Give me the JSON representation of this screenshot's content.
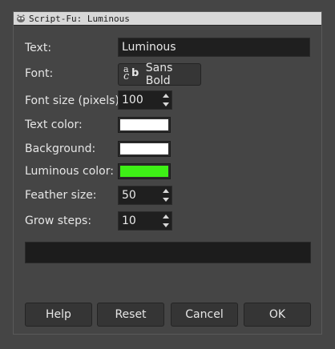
{
  "window": {
    "title": "Script-Fu: Luminous"
  },
  "fields": {
    "text": {
      "label": "Text:",
      "value": "Luminous"
    },
    "font": {
      "label": "Font:",
      "value": "Sans Bold",
      "glyph_top": "a",
      "glyph_bottom": "c",
      "glyph_bold": "b"
    },
    "font_size": {
      "label": "Font size (pixels):",
      "value": "100"
    },
    "text_color": {
      "label": "Text color:",
      "color": "#ffffff"
    },
    "background": {
      "label": "Background:",
      "color": "#ffffff"
    },
    "luminous_color": {
      "label": "Luminous color:",
      "color": "#3ef016"
    },
    "feather_size": {
      "label": "Feather size:",
      "value": "50"
    },
    "grow_steps": {
      "label": "Grow steps:",
      "value": "10"
    }
  },
  "buttons": {
    "help": "Help",
    "reset": "Reset",
    "cancel": "Cancel",
    "ok": "OK"
  },
  "icons": {
    "title": "gimp-wilber-icon",
    "font": "font-glyph-icon",
    "spin_up": "arrow-up-icon",
    "spin_down": "arrow-down-icon"
  }
}
